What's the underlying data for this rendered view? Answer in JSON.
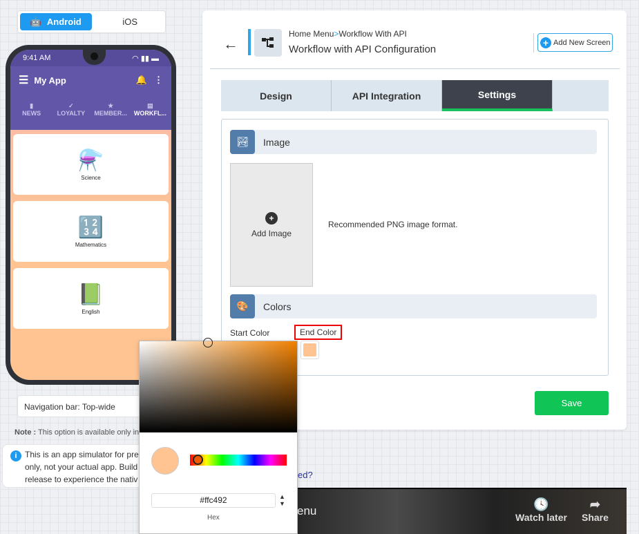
{
  "platform_toggle": {
    "android": "Android",
    "ios": "iOS",
    "selected": "Android"
  },
  "phone": {
    "time": "9:41 AM",
    "app_title": "My App",
    "tabs": [
      {
        "label": "NEWS",
        "icon": "bookmark-icon"
      },
      {
        "label": "LOYALTY",
        "icon": "check-icon"
      },
      {
        "label": "MEMBER...",
        "icon": "star-icon"
      },
      {
        "label": "WORKFL...",
        "icon": "document-icon"
      }
    ],
    "cards": [
      {
        "label": "Science",
        "icon": "⚗️"
      },
      {
        "label": "Mathematics",
        "icon": "🔢"
      },
      {
        "label": "English",
        "icon": "📗"
      }
    ]
  },
  "navigation_bar": "Navigation bar: Top-wide",
  "note": {
    "bold": "Note :",
    "text": " This option is available only in"
  },
  "info": [
    "This is an app simulator for pre",
    "only, not your actual app. Build",
    "release to experience the nativ"
  ],
  "header": {
    "breadcrumb": [
      "Home Menu",
      "Workflow With API"
    ],
    "separator": ">",
    "title": "Workflow with API Configuration",
    "add_button": "Add New Screen"
  },
  "tabs": [
    {
      "label": "Design"
    },
    {
      "label": "API Integration"
    },
    {
      "label": "Settings",
      "active": true
    }
  ],
  "image_section": {
    "title": "Image",
    "add_image": "Add Image",
    "recommendation": "Recommended PNG image format."
  },
  "colors_section": {
    "title": "Colors",
    "start_label": "Start Color",
    "end_label": "End Color",
    "end_value": "#ffc492"
  },
  "save_label": "Save",
  "color_picker": {
    "hex_value": "#ffc492",
    "mode_label": "Hex"
  },
  "link_partial": "ed?",
  "video": {
    "title_partial": "enu",
    "watch_later": "Watch later",
    "share": "Share"
  },
  "colors": {
    "accent": "#1e9bf0",
    "save": "#10c456",
    "active_tab": "#3d424c",
    "phone_header": "#6256a8"
  }
}
